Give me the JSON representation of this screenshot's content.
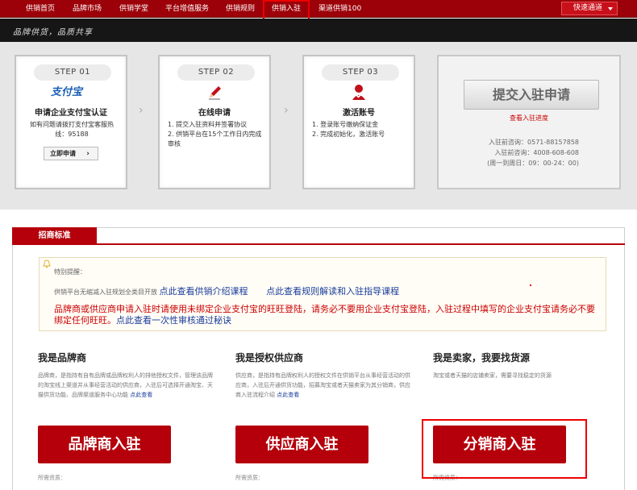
{
  "topnav": {
    "items": [
      "供销首页",
      "品牌市场",
      "供销学堂",
      "平台增值服务",
      "供销规则",
      "供销入驻",
      "渠道供销100"
    ],
    "quick": "快速通道"
  },
  "slogan": "品牌供货，品质共享",
  "steps": [
    {
      "tag": "STEP 01",
      "logo": "支付宝",
      "title": "申请企业支付宝认证",
      "desc": "如有问题请拨打支付宝客服热线：95188",
      "button": "立即申请"
    },
    {
      "tag": "STEP 02",
      "title": "在线申请",
      "lines": [
        "1. 提交入驻资料并签署协议",
        "2. 供销平台在15个工作日内完成审核"
      ]
    },
    {
      "tag": "STEP 03",
      "title": "激活账号",
      "lines": [
        "1. 登录账号缴纳保证金",
        "2. 完成初始化，激活账号"
      ]
    }
  ],
  "submit": {
    "button": "提交入驻申请",
    "progress": "查看入驻进度",
    "hotline1": "入驻前咨询：0571-88157858",
    "hotline2": "入驻前咨询：4008-608-608",
    "hours": "(周一到周日：09：00-24：00)"
  },
  "section": {
    "tab": "招商标准",
    "special": "特别提醒：",
    "line1_prefix": "供销平台无缩减入驻规划全类目开放",
    "link1": "点此查看供销介绍课程",
    "link2": "点此查看规则解读和入驻指导课程",
    "warning": "品牌商或供应商申请入驻时请使用未绑定企业支付宝的旺旺登陆，请务必不要用企业支付宝登陆，入驻过程中填写的企业支付宝请务必不要绑定任何旺旺。",
    "warning_link": "点此查看一次性审核通过秘诀"
  },
  "columns": [
    {
      "title": "我是品牌商",
      "desc": "品牌商，是指持有自有品牌或品牌权利人的排他授权文件，管理该品牌的淘宝线上渠道并从事经营活动的供应商，入驻后可选择开通淘宝、天猫供货功能、品牌渠道服务中心功能",
      "link": "点此查看",
      "button": "品牌商入驻",
      "foot": "所需资质："
    },
    {
      "title": "我是授权供应商",
      "desc": "供应商，是指持有品牌权利人的授权文件在供销平台从事经营活动的供应商，入驻后开通供货功能，招募淘宝或者天猫卖家为其分销商，供应商入驻流程介绍",
      "link": "点此查看",
      "button": "供应商入驻",
      "foot": "所需资质："
    },
    {
      "title": "我是卖家，我要找货源",
      "desc": "淘宝或者天猫的店铺卖家，需要寻找稳定的货源",
      "button": "分销商入驻",
      "foot": "所需资质："
    }
  ]
}
